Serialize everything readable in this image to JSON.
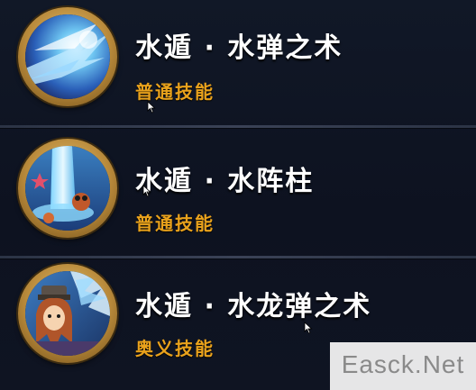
{
  "skills": [
    {
      "name": "水遁 · 水弹之术",
      "type": "普通技能",
      "icon": "water-bullet-icon"
    },
    {
      "name": "水遁 · 水阵柱",
      "type": "普通技能",
      "icon": "water-pillar-icon"
    },
    {
      "name": "水遁 · 水龙弹之术",
      "type": "奥义技能",
      "icon": "water-dragon-icon"
    }
  ],
  "colors": {
    "name_text": "#ffffff",
    "type_text": "#e9a21c",
    "ring_gold": "#c9a04a",
    "background": "#0e1320"
  },
  "watermark": {
    "text": "Easck.Net"
  }
}
